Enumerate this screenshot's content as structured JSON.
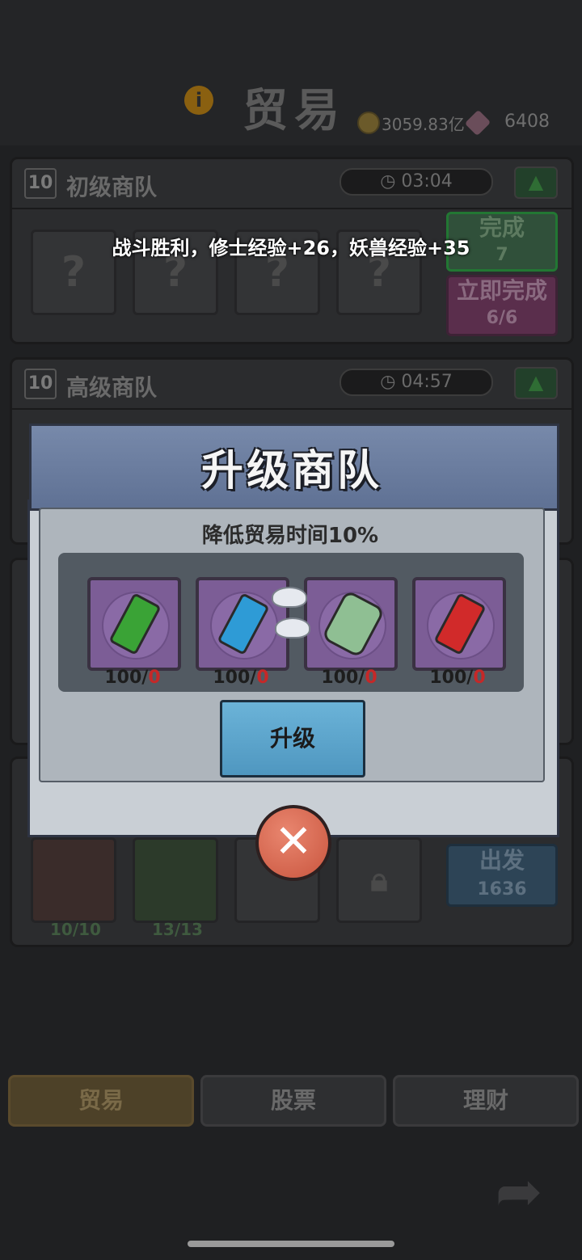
{
  "header": {
    "title": "贸易",
    "coins": "3059.83亿",
    "gems": "6408"
  },
  "caravans": [
    {
      "level": "10",
      "name": "初级商队",
      "timer": "03:04",
      "slots": [
        "?",
        "?",
        "?",
        "?"
      ],
      "complete_label": "完成",
      "complete_count": "7",
      "instant_label": "立即完成",
      "instant_count": "6/6"
    },
    {
      "level": "10",
      "name": "高级商队",
      "timer": "04:57"
    },
    {
      "slot_counts": [
        "10/10",
        "13/13"
      ],
      "depart_label": "出发",
      "depart_cost": "1636"
    }
  ],
  "toast": "战斗胜利，修士经验+26，妖兽经验+35",
  "modal": {
    "title": "升级商队",
    "description": "降低贸易时间10%",
    "items": [
      {
        "icon": "green-crystal-icon",
        "need": "100/",
        "have": "0",
        "color": "#3aa336"
      },
      {
        "icon": "blue-crystal-icon",
        "need": "100/",
        "have": "0",
        "color": "#2e9bd6"
      },
      {
        "icon": "green-talisman-icon",
        "need": "100/",
        "have": "0",
        "color": "#8fbf93"
      },
      {
        "icon": "red-crystal-icon",
        "need": "100/",
        "have": "0",
        "color": "#d12a2a"
      }
    ],
    "upgrade_button": "升级",
    "close_icon": "✕"
  },
  "bottom_tabs": [
    "贸易",
    "股票",
    "理财"
  ]
}
